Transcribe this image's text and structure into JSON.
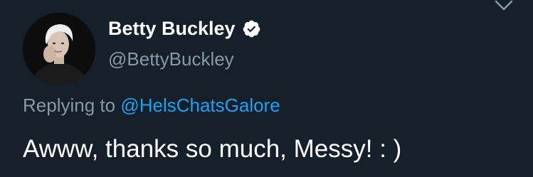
{
  "tweet": {
    "author": {
      "display_name": "Betty Buckley",
      "handle": "@BettyBuckley",
      "verified": true,
      "avatar_icon": "profile-photo"
    },
    "reply_context": {
      "prefix": "Replying to",
      "mention": "@HelsChatsGalore"
    },
    "text": "Awww, thanks so much, Messy! : )",
    "menu_icon": "chevron-down-icon"
  },
  "colors": {
    "background": "#15202b",
    "primary_text": "#ffffff",
    "secondary_text": "#8899a6",
    "link": "#1da1f2",
    "verified_badge": "#ffffff"
  }
}
